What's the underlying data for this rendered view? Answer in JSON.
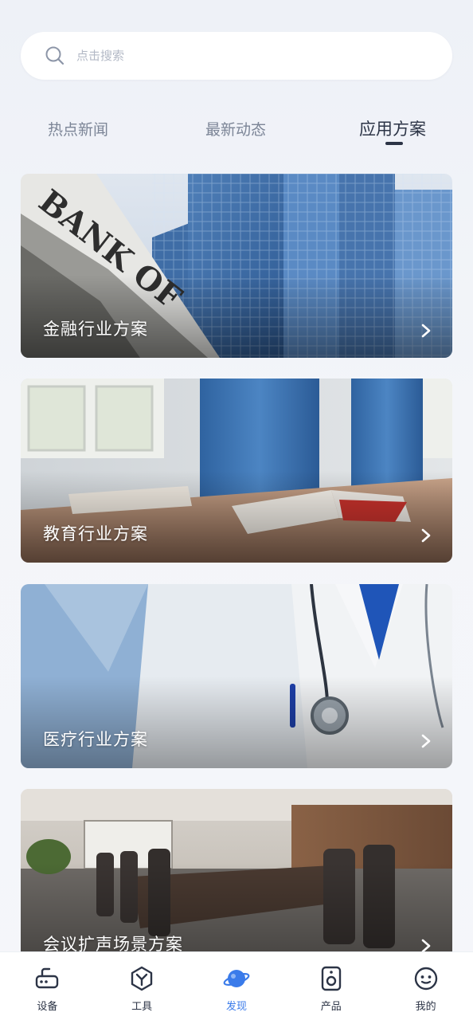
{
  "search": {
    "placeholder": "点击搜索"
  },
  "tabs": [
    {
      "label": "热点新闻",
      "active": false
    },
    {
      "label": "最新动态",
      "active": false
    },
    {
      "label": "应用方案",
      "active": true
    }
  ],
  "cards": [
    {
      "title": "金融行业方案",
      "image": "bank-building"
    },
    {
      "title": "教育行业方案",
      "image": "classroom-book"
    },
    {
      "title": "医疗行业方案",
      "image": "doctor-stethoscope"
    },
    {
      "title": "会议扩声场景方案",
      "image": "conference-room"
    }
  ],
  "nav": [
    {
      "label": "设备",
      "icon": "router-icon",
      "active": false
    },
    {
      "label": "工具",
      "icon": "tools-icon",
      "active": false
    },
    {
      "label": "发现",
      "icon": "planet-icon",
      "active": true
    },
    {
      "label": "产品",
      "icon": "speaker-icon",
      "active": false
    },
    {
      "label": "我的",
      "icon": "face-icon",
      "active": false
    }
  ],
  "colors": {
    "accent": "#3a7bea",
    "text_dark": "#2c3446",
    "text_muted": "#7c8597"
  }
}
